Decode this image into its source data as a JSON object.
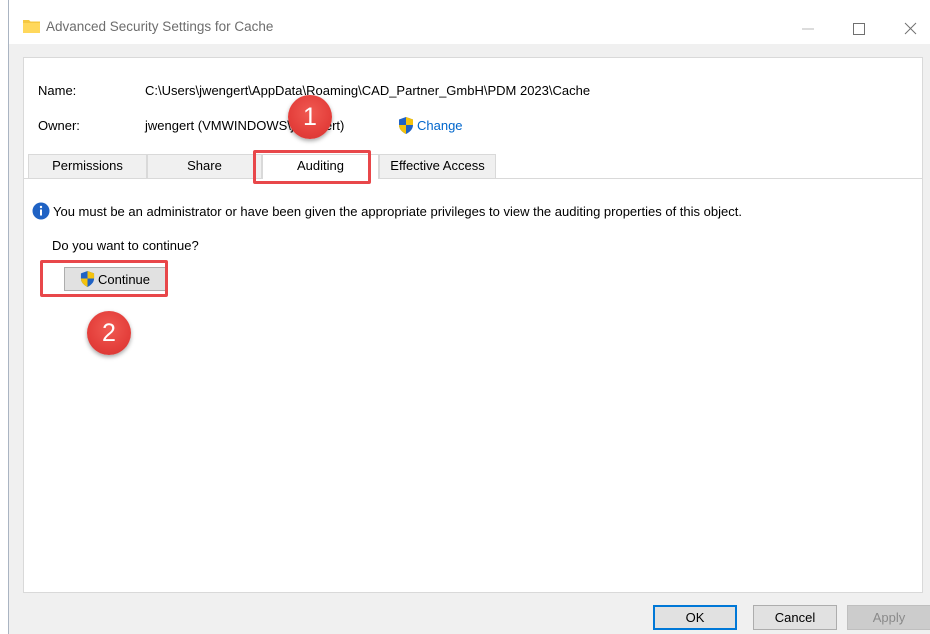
{
  "window": {
    "title": "Advanced Security Settings for Cache",
    "icon": "folder-icon",
    "controls": [
      "minimize",
      "maximize",
      "close"
    ]
  },
  "info": {
    "name_label": "Name:",
    "name_value": "C:\\Users\\jwengert\\AppData\\Roaming\\CAD_Partner_GmbH\\PDM 2023\\Cache",
    "owner_label": "Owner:",
    "owner_value": "jwengert (VMWINDOWS\\jwengert)",
    "change_link": "Change"
  },
  "tabs": [
    {
      "label": "Permissions",
      "active": false
    },
    {
      "label": "Share",
      "active": false
    },
    {
      "label": "Auditing",
      "active": true
    },
    {
      "label": "Effective Access",
      "active": false
    }
  ],
  "auditing": {
    "notice": "You must be an administrator or have been given the appropriate privileges to view the auditing properties of this object.",
    "question": "Do you want to continue?",
    "continue_label": "Continue"
  },
  "callouts": [
    "1",
    "2"
  ],
  "footer": {
    "ok": "OK",
    "cancel": "Cancel",
    "apply": "Apply"
  },
  "colors": {
    "highlight": "#e8474a",
    "link": "#0066cc",
    "default_button_border": "#0078d7"
  }
}
